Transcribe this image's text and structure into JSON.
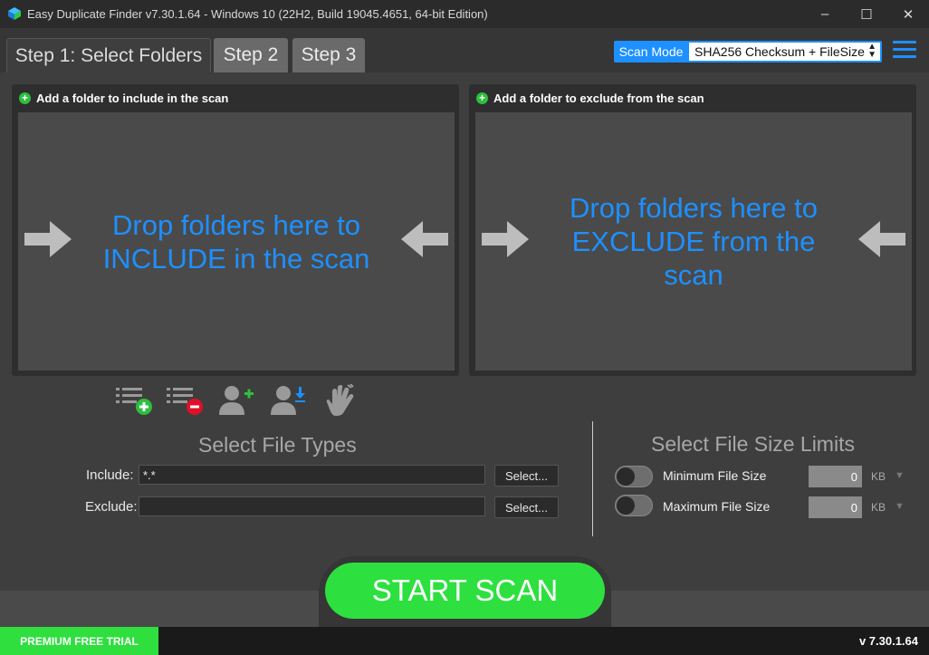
{
  "window": {
    "title": "Easy Duplicate Finder v7.30.1.64 - Windows 10 (22H2, Build 19045.4651, 64-bit Edition)",
    "minimize": "–",
    "maximize": "☐",
    "close": "✕"
  },
  "tabs": [
    {
      "label": "Step 1: Select Folders",
      "active": true
    },
    {
      "label": "Step 2",
      "active": false
    },
    {
      "label": "Step 3",
      "active": false
    }
  ],
  "scan_mode": {
    "label": "Scan Mode",
    "value": "SHA256 Checksum + FileSize",
    "arrow": "▲▼"
  },
  "include_panel": {
    "header": "Add a folder to include in the scan",
    "drop_text_line1": "Drop folders here to",
    "drop_text_line2": "INCLUDE in the scan"
  },
  "exclude_panel": {
    "header": "Add a folder to exclude from the scan",
    "drop_text_line1": "Drop folders here to",
    "drop_text_line2": "EXCLUDE from the",
    "drop_text_line3": "scan"
  },
  "toolbar_icons": [
    "add-list-icon",
    "remove-list-icon",
    "add-user-folder-icon",
    "import-user-folder-icon",
    "hand-wave-icon"
  ],
  "file_types": {
    "title": "Select File Types",
    "include_label": "Include:",
    "include_value": "*.*",
    "exclude_label": "Exclude:",
    "exclude_value": "",
    "select_label": "Select..."
  },
  "size_limits": {
    "title": "Select File Size Limits",
    "min_label": "Minimum File Size",
    "min_value": "0",
    "max_label": "Maximum File Size",
    "max_value": "0",
    "unit": "KB",
    "dropdown": "▼"
  },
  "start_scan": "START SCAN",
  "status": {
    "premium": "PREMIUM FREE TRIAL",
    "version": "v 7.30.1.64"
  },
  "colors": {
    "accent_blue": "#1e90ff",
    "accent_green": "#2ee03f",
    "background": "#3e3e3e"
  }
}
